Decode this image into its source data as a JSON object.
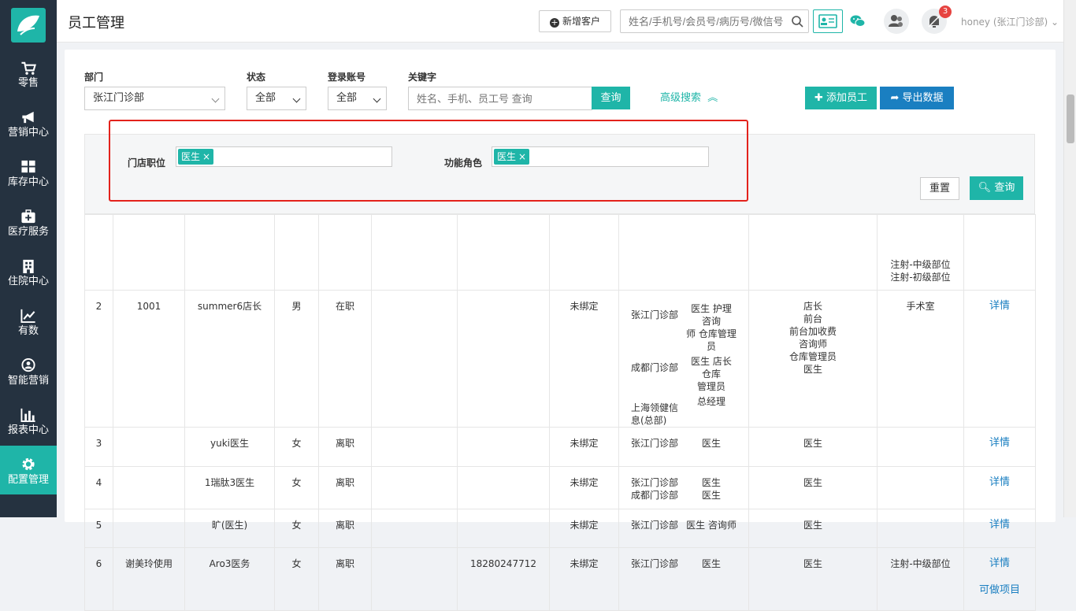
{
  "header": {
    "title": "员工管理",
    "new_customer": "新增客户",
    "search_placeholder": "姓名/手机号/会员号/病历号/微信号",
    "notification_count": "3",
    "user": "honey (张江门诊部)"
  },
  "sidebar": {
    "items": [
      {
        "label": "零售",
        "icon": "cart-icon"
      },
      {
        "label": "营销中心",
        "icon": "megaphone-icon"
      },
      {
        "label": "库存中心",
        "icon": "grid-icon"
      },
      {
        "label": "医疗服务",
        "icon": "medical-kit-icon"
      },
      {
        "label": "住院中心",
        "icon": "hospital-icon"
      },
      {
        "label": "有数",
        "icon": "line-chart-icon"
      },
      {
        "label": "智能营销",
        "icon": "target-icon"
      },
      {
        "label": "报表中心",
        "icon": "bar-chart-icon"
      },
      {
        "label": "配置管理",
        "icon": "gear-icon"
      }
    ]
  },
  "filters": {
    "dept_label": "部门",
    "dept_value": "张江门诊部",
    "status_label": "状态",
    "status_value": "全部",
    "account_label": "登录账号",
    "account_value": "全部",
    "keyword_label": "关键字",
    "keyword_placeholder": "姓名、手机、员工号 查询",
    "query": "查询",
    "advanced": "高级搜索",
    "add_staff": "添加员工",
    "export": "导出数据"
  },
  "advanced": {
    "position_label": "门店职位",
    "position_tag": "医生",
    "role_label": "功能角色",
    "role_tag": "医生",
    "reset": "重置",
    "query": "查询"
  },
  "table": {
    "partial_row": {
      "level_lines": [
        "注射-中级部位",
        "注射-初级部位"
      ]
    },
    "rows": [
      {
        "no": "2",
        "emp_no": "1001",
        "name": "summer6店长",
        "gender": "男",
        "status": "在职",
        "col6": "",
        "phone": "",
        "bind": "未绑定",
        "stores": [
          {
            "store": [
              "张江门诊部"
            ],
            "pos": [
              "医生 护理 咨询",
              "师 仓库管理员"
            ]
          },
          {
            "store": [
              "成都门诊部"
            ],
            "pos": [
              "医生 店长 仓库",
              "管理员"
            ]
          },
          {
            "store": [
              "上海领健信",
              "息(总部)"
            ],
            "pos": [
              "总经理"
            ]
          }
        ],
        "roles": [
          "店长",
          "前台",
          "前台加收费",
          "咨询师",
          "仓库管理员",
          "医生"
        ],
        "level": "手术室",
        "detail": "详情",
        "extra": ""
      },
      {
        "no": "3",
        "emp_no": "",
        "name": "yuki医生",
        "gender": "女",
        "status": "离职",
        "col6": "",
        "phone": "",
        "bind": "未绑定",
        "stores": [
          {
            "store": [
              "张江门诊部"
            ],
            "pos": [
              "医生"
            ]
          }
        ],
        "roles": [
          "医生"
        ],
        "level": "",
        "detail": "详情",
        "extra": ""
      },
      {
        "no": "4",
        "emp_no": "",
        "name": "1瑞肽3医生",
        "gender": "女",
        "status": "离职",
        "col6": "",
        "phone": "",
        "bind": "未绑定",
        "stores": [
          {
            "store": [
              "张江门诊部"
            ],
            "pos": [
              "医生"
            ]
          },
          {
            "store": [
              "成都门诊部"
            ],
            "pos": [
              "医生"
            ]
          }
        ],
        "roles": [
          "医生"
        ],
        "level": "",
        "detail": "详情",
        "extra": ""
      },
      {
        "no": "5",
        "emp_no": "",
        "name": "旷(医生)",
        "gender": "女",
        "status": "离职",
        "col6": "",
        "phone": "",
        "bind": "未绑定",
        "stores": [
          {
            "store": [
              "张江门诊部"
            ],
            "pos": [
              "医生 咨询师"
            ]
          }
        ],
        "roles": [
          "医生"
        ],
        "level": "",
        "detail": "详情",
        "extra": ""
      },
      {
        "no": "6",
        "emp_no": "谢美玲使用",
        "name": "Aro3医务",
        "gender": "女",
        "status": "离职",
        "col6": "",
        "phone": "18280247712",
        "bind": "未绑定",
        "stores": [
          {
            "store": [
              "张江门诊部"
            ],
            "pos": [
              "医生"
            ]
          }
        ],
        "roles": [
          "医生"
        ],
        "level": "注射-中级部位",
        "detail": "详情",
        "extra": "可做项目"
      }
    ]
  }
}
